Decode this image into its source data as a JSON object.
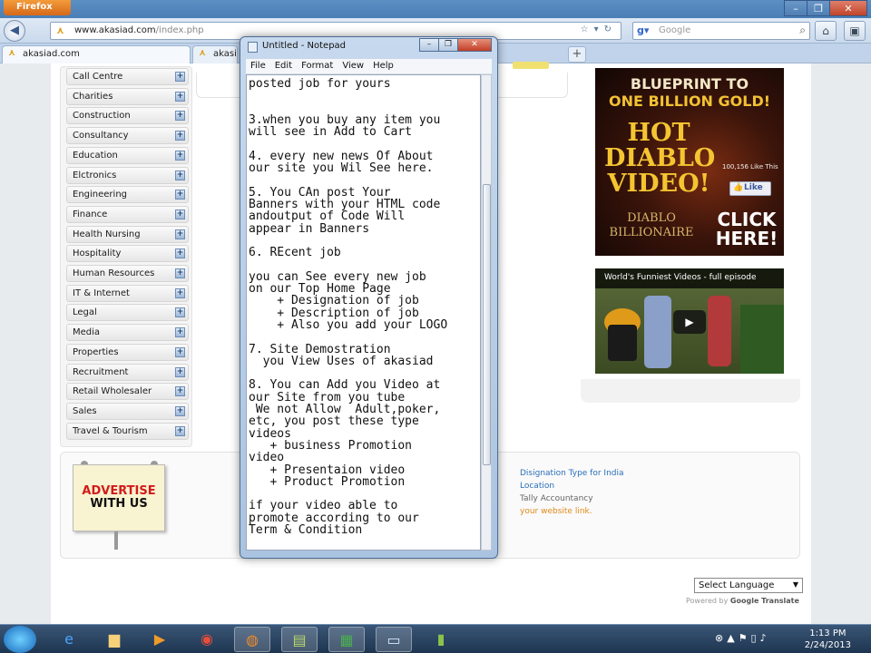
{
  "browser": {
    "menu_label": "Firefox",
    "url_domain": "www.akasiad.com",
    "url_path": "/index.php",
    "search_placeholder": "Google",
    "tabs": [
      {
        "label": "akasiad.com"
      },
      {
        "label": "akasi"
      }
    ]
  },
  "sidebar": {
    "items": [
      {
        "label": "Call Centre"
      },
      {
        "label": "Charities"
      },
      {
        "label": "Construction"
      },
      {
        "label": "Consultancy"
      },
      {
        "label": "Education"
      },
      {
        "label": "Elctronics"
      },
      {
        "label": "Engineering"
      },
      {
        "label": "Finance"
      },
      {
        "label": "Health Nursing"
      },
      {
        "label": "Hospitality"
      },
      {
        "label": "Human Resources"
      },
      {
        "label": "IT & Internet"
      },
      {
        "label": "Legal"
      },
      {
        "label": "Media"
      },
      {
        "label": "Properties"
      },
      {
        "label": "Recruitment"
      },
      {
        "label": "Retail Wholesaler"
      },
      {
        "label": "Sales"
      },
      {
        "label": "Travel & Tourism"
      }
    ],
    "expand_glyph": "+"
  },
  "ad_diablo": {
    "line1": "BLUEPRINT TO",
    "line2": "ONE BILLION GOLD!",
    "hot": "HOT DIABLO VIDEO!",
    "brand": "DIABLO BILLIONAIRE",
    "cta": "CLICK HERE!",
    "like_label": "Like",
    "like_count": "100,156 Like This"
  },
  "video": {
    "title": "World's Funniest Videos - full episode"
  },
  "advertise": {
    "line1": "ADVERTISE",
    "line2": "WITH US"
  },
  "links": {
    "designation": "Disignation Type for India",
    "location": "Location",
    "tally": "Tally Accountancy",
    "your_site": "your website link."
  },
  "translate": {
    "select_label": "Select Language",
    "powered_prefix": "Powered by",
    "powered_brand": "Google Translate"
  },
  "notepad": {
    "title": "Untitled - Notepad",
    "menu": [
      "File",
      "Edit",
      "Format",
      "View",
      "Help"
    ],
    "text": "posted job for yours\n\n\n3.when you buy any item you\nwill see in Add to Cart\n\n4. every new news Of About\nour site you Wil See here.\n\n5. You CAn post Your\nBanners with your HTML code\nandoutput of Code Will\nappear in Banners\n\n6. REcent job\n\nyou can See every new job\non our Top Home Page\n    + Designation of job\n    + Description of job\n    + Also you add your LOGO\n\n7. Site Demostration\n  you View Uses of akasiad\n\n8. You can Add you Video at\nour Site from you tube\n We not Allow  Adult,poker,\netc, you post these type\nvideos\n   + business Promotion\nvideo\n   + Presentaion video\n   + Product Promotion\n\nif your video able to\npromote according to our\nTerm & Condition"
  },
  "taskbar": {
    "time": "1:13 PM",
    "date": "2/24/2013"
  },
  "colors": {
    "link_blue": "#2a6fb8",
    "link_orange": "#e08a1a",
    "ad_gold": "#f5c531",
    "advertise_red": "#d11b1b"
  }
}
